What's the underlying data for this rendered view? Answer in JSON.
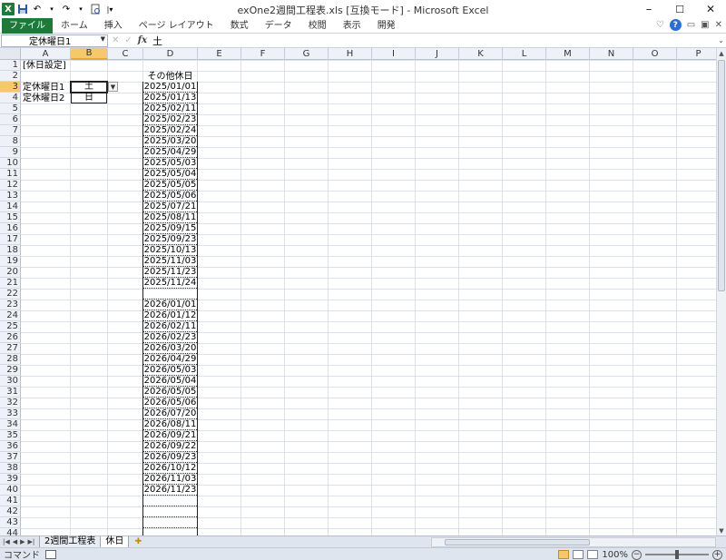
{
  "window": {
    "title": "exOne2週間工程表.xls [互換モード] - Microsoft Excel",
    "minimize": "–",
    "maximize": "☐",
    "close": "✕"
  },
  "ribbon": {
    "tabs": [
      "ファイル",
      "ホーム",
      "挿入",
      "ページ レイアウト",
      "数式",
      "データ",
      "校閲",
      "表示",
      "開発"
    ],
    "right_icons": [
      "♡",
      "?",
      "▭",
      "▣",
      "✕"
    ]
  },
  "formula_bar": {
    "name_box": "定休曜日1",
    "fx": "fx",
    "formula": "土"
  },
  "columns": [
    "A",
    "B",
    "C",
    "D",
    "E",
    "F",
    "G",
    "H",
    "I",
    "J",
    "K",
    "L",
    "M",
    "N",
    "O",
    "P"
  ],
  "rows": [
    "1",
    "2",
    "3",
    "4",
    "5",
    "6",
    "7",
    "8",
    "9",
    "10",
    "11",
    "12",
    "13",
    "14",
    "15",
    "16",
    "17",
    "18",
    "19",
    "20",
    "21",
    "22",
    "23",
    "24",
    "25",
    "26",
    "27",
    "28",
    "29",
    "30",
    "31",
    "32",
    "33",
    "34",
    "35",
    "36",
    "37",
    "38",
    "39",
    "40",
    "41",
    "42",
    "43",
    "44"
  ],
  "cells": {
    "a1": "[休日設定]",
    "a3": "定休曜日1",
    "a4": "定休曜日2",
    "b3": "土",
    "b4": "日",
    "d2": "その他休日"
  },
  "holidays_2025": [
    "2025/01/01",
    "2025/01/13",
    "2025/02/11",
    "2025/02/23",
    "2025/02/24",
    "2025/03/20",
    "2025/04/29",
    "2025/05/03",
    "2025/05/04",
    "2025/05/05",
    "2025/05/06",
    "2025/07/21",
    "2025/08/11",
    "2025/09/15",
    "2025/09/23",
    "2025/10/13",
    "2025/11/03",
    "2025/11/23",
    "2025/11/24"
  ],
  "holidays_2026": [
    "2026/01/01",
    "2026/01/12",
    "2026/02/11",
    "2026/02/23",
    "2026/03/20",
    "2026/04/29",
    "2026/05/03",
    "2026/05/04",
    "2026/05/05",
    "2026/05/06",
    "2026/07/20",
    "2026/08/11",
    "2026/09/21",
    "2026/09/22",
    "2026/09/23",
    "2026/10/12",
    "2026/11/03",
    "2026/11/23"
  ],
  "sheets": {
    "tabs": [
      "2週間工程表",
      "休日"
    ],
    "active": "休日"
  },
  "status": {
    "mode": "コマンド",
    "zoom": "100%"
  }
}
